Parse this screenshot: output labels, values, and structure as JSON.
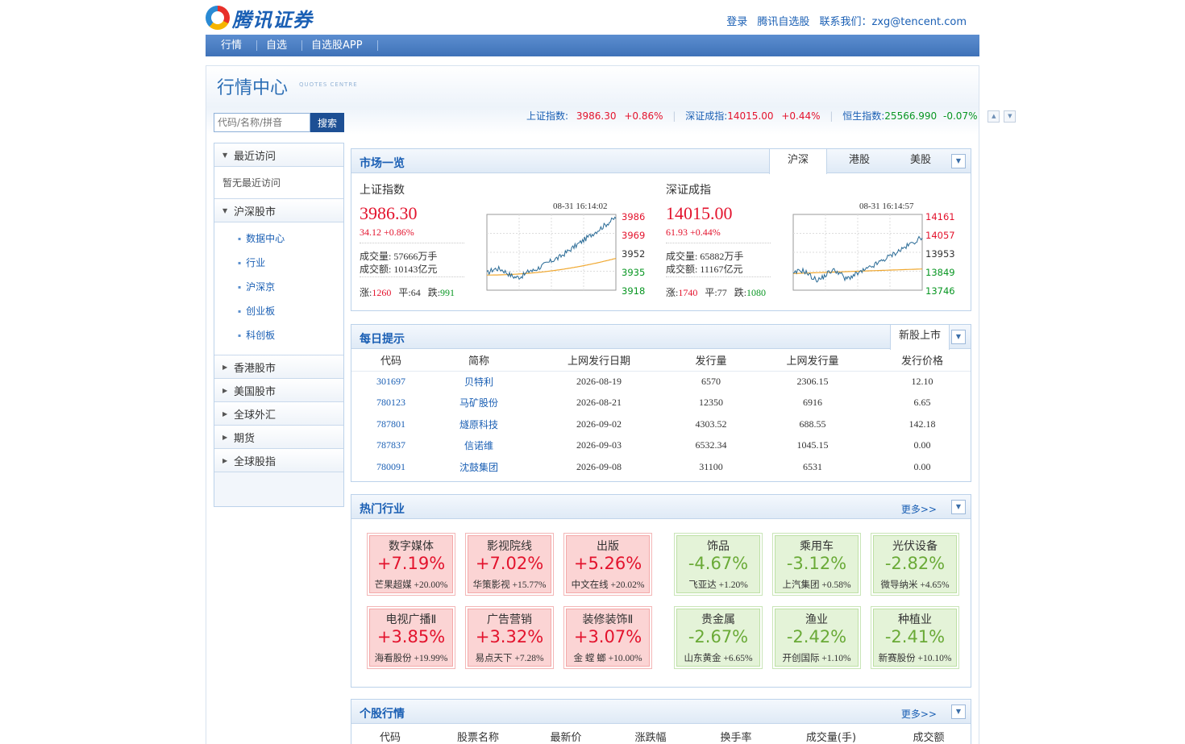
{
  "header": {
    "logo_text": "腾讯证券",
    "links": [
      "登录",
      "腾讯自选股",
      "联系我们：zxg@tencent.com"
    ]
  },
  "nav": [
    "行情",
    "自选",
    "自选股APP"
  ],
  "page": {
    "title": "行情中心",
    "title_en": "QUOTES CENTRE"
  },
  "index_bar": [
    {
      "label": "上证指数:",
      "value": "3986.30",
      "change": "+0.86%",
      "trend": "up"
    },
    {
      "label": "深证成指:",
      "value": "14015.00",
      "change": "+0.44%",
      "trend": "up"
    },
    {
      "label": "恒生指数:",
      "value": "25566.990",
      "change": "-0.07%",
      "trend": "down"
    }
  ],
  "search": {
    "placeholder": "代码/名称/拼音",
    "button": "搜索"
  },
  "sidebar": {
    "recent": "最近访问",
    "recent_empty": "暂无最近访问",
    "hs": "沪深股市",
    "hs_items": [
      "数据中心",
      "行业",
      "沪深京",
      "创业板",
      "科创板"
    ],
    "others": [
      "香港股市",
      "美国股市",
      "全球外汇",
      "期货",
      "全球股指"
    ]
  },
  "market": {
    "title": "市场一览",
    "tabs": [
      "沪深",
      "港股",
      "美股"
    ],
    "indices": [
      {
        "name": "上证指数",
        "price": "3986.30",
        "change": "34.12 +0.86%",
        "volume": "成交量: 57666万手",
        "amount": "成交额: 10143亿元",
        "up_label": "涨:",
        "up": "1260",
        "flat_label": "平:",
        "flat": "64",
        "down_label": "跌:",
        "down": "991",
        "time": "08-31 16:14:02",
        "ticks": [
          "3986",
          "3969",
          "3952",
          "3935",
          "3918"
        ],
        "line_color": "#2a6b96",
        "avg_color": "#f0a830"
      },
      {
        "name": "深证成指",
        "price": "14015.00",
        "change": "61.93 +0.44%",
        "volume": "成交量: 65882万手",
        "amount": "成交额: 11167亿元",
        "up_label": "涨:",
        "up": "1740",
        "flat_label": "平:",
        "flat": "77",
        "down_label": "跌:",
        "down": "1080",
        "time": "08-31 16:14:57",
        "ticks": [
          "14161",
          "14057",
          "13953",
          "13849",
          "13746"
        ],
        "line_color": "#2a6b96",
        "avg_color": "#f0a830"
      }
    ]
  },
  "ipo": {
    "title": "每日提示",
    "tab": "新股上市",
    "columns": [
      "代码",
      "简称",
      "上网发行日期",
      "发行量",
      "上网发行量",
      "发行价格"
    ],
    "rows": [
      [
        "301697",
        "贝特利",
        "2026-08-19",
        "6570",
        "2306.15",
        "12.10"
      ],
      [
        "780123",
        "马矿股份",
        "2026-08-21",
        "12350",
        "6916",
        "6.65"
      ],
      [
        "787801",
        "燧原科技",
        "2026-09-02",
        "4303.52",
        "688.55",
        "142.18"
      ],
      [
        "787837",
        "信诺维",
        "2026-09-03",
        "6532.34",
        "1045.15",
        "0.00"
      ],
      [
        "780091",
        "沈鼓集团",
        "2026-09-08",
        "31100",
        "6531",
        "0.00"
      ]
    ]
  },
  "hot": {
    "title": "热门行业",
    "more": "更多>>",
    "sectors": [
      {
        "name": "数字媒体",
        "pct": "+7.19%",
        "lead": "芒果超媒",
        "lead_pct": "+20.00%",
        "trend": "up"
      },
      {
        "name": "影视院线",
        "pct": "+7.02%",
        "lead": "华策影视",
        "lead_pct": "+15.77%",
        "trend": "up"
      },
      {
        "name": "出版",
        "pct": "+5.26%",
        "lead": "中文在线",
        "lead_pct": "+20.02%",
        "trend": "up"
      },
      {
        "name": "饰品",
        "pct": "-4.67%",
        "lead": "飞亚达",
        "lead_pct": "+1.20%",
        "trend": "down"
      },
      {
        "name": "乘用车",
        "pct": "-3.12%",
        "lead": "上汽集团",
        "lead_pct": "+0.58%",
        "trend": "down"
      },
      {
        "name": "光伏设备",
        "pct": "-2.82%",
        "lead": "微导纳米",
        "lead_pct": "+4.65%",
        "trend": "down"
      },
      {
        "name": "电视广播Ⅱ",
        "pct": "+3.85%",
        "lead": "海看股份",
        "lead_pct": "+19.99%",
        "trend": "up"
      },
      {
        "name": "广告营销",
        "pct": "+3.32%",
        "lead": "易点天下",
        "lead_pct": "+7.28%",
        "trend": "up"
      },
      {
        "name": "装修装饰Ⅱ",
        "pct": "+3.07%",
        "lead": "金 螳 螂",
        "lead_pct": "+10.00%",
        "trend": "up"
      },
      {
        "name": "贵金属",
        "pct": "-2.67%",
        "lead": "山东黄金",
        "lead_pct": "+6.65%",
        "trend": "down"
      },
      {
        "name": "渔业",
        "pct": "-2.42%",
        "lead": "开创国际",
        "lead_pct": "+1.10%",
        "trend": "down"
      },
      {
        "name": "种植业",
        "pct": "-2.41%",
        "lead": "新赛股份",
        "lead_pct": "+10.10%",
        "trend": "down"
      }
    ]
  },
  "stocks": {
    "title": "个股行情",
    "more": "更多>>",
    "columns": [
      "代码",
      "股票名称",
      "最新价",
      "涨跌幅",
      "换手率",
      "成交量(手)",
      "成交额"
    ]
  }
}
